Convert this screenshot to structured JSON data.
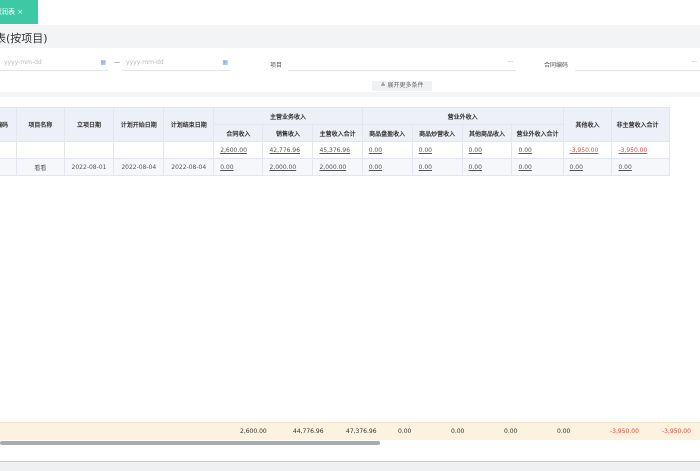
{
  "tab": {
    "label": "利润表",
    "close": "×"
  },
  "page_title": "表(按项目)",
  "filters": {
    "date_start_placeholder": "yyyy-mm-dd",
    "date_end_placeholder": "yyyy-mm-dd",
    "range_sep": "—",
    "project_label": "项目",
    "project_btn": "···",
    "contract_label": "合同编码",
    "contract_btn": "···",
    "expand_label": "展开更多条件",
    "expand_icon": "chevron-double-down"
  },
  "table": {
    "headers": {
      "code": "编码",
      "name": "项目名称",
      "setup_date": "立项日期",
      "plan_start": "计划开始日期",
      "plan_end": "计划结束日期",
      "main_group": "主营业务收入",
      "contract_income": "合同收入",
      "sales_income": "销售收入",
      "main_total": "主营收入合计",
      "other_group": "营业外收入",
      "inventory_income": "商品盘盈收入",
      "goods_income": "商品炒营收入",
      "other_goods_income": "其他商品收入",
      "nonop_total": "营业外收入合计",
      "other_income": "其他收入",
      "non_main_total": "非主营收入合计"
    },
    "summary": [
      "",
      "",
      "",
      "",
      "",
      "2,600.00",
      "42,776.96",
      "45,376.96",
      "0.00",
      "0.00",
      "0.00",
      "0.00",
      "-3,950.00",
      "-3,950.00"
    ],
    "rows": [
      [
        "",
        "看看",
        "2022-08-01",
        "2022-08-04",
        "2022-08-04",
        "0.00",
        "2,000.00",
        "2,000.00",
        "0.00",
        "0.00",
        "0.00",
        "0.00",
        "0.00",
        "0.00"
      ]
    ]
  },
  "totals": [
    "2,600.00",
    "44,776.96",
    "47,376.96",
    "0.00",
    "0.00",
    "0.00",
    "0.00",
    "-3,950.00",
    "-3,950.00"
  ],
  "colors": {
    "accent": "#3cc9a4",
    "negative": "#e0473f",
    "totals_bg": "#fdf2de"
  }
}
